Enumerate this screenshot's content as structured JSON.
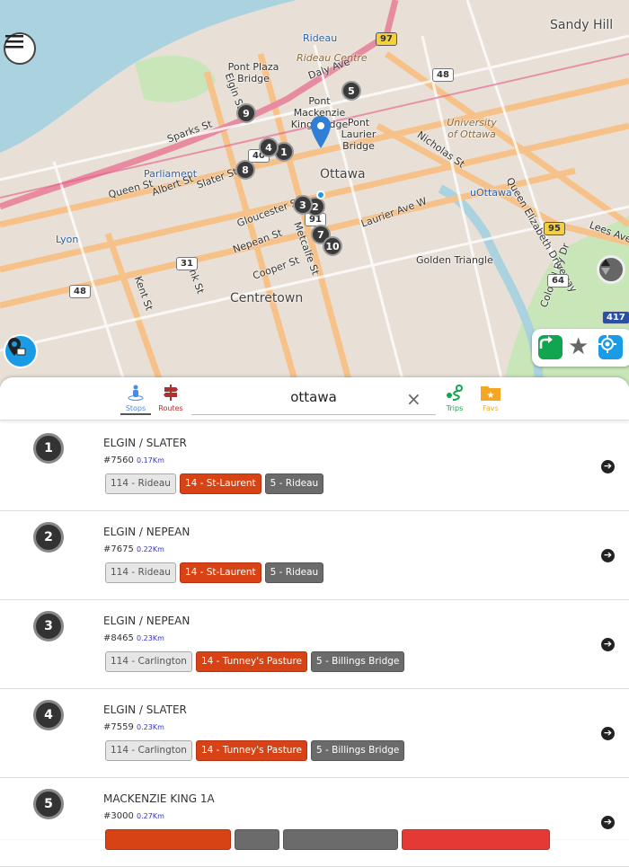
{
  "map": {
    "labels": [
      {
        "text": "Sandy Hill",
        "cls": "big"
      },
      {
        "text": "Rideau",
        "cls": "blue"
      },
      {
        "text": "Rideau Centre",
        "cls": "brown"
      },
      {
        "text": "Pont Plaza Bridge",
        "cls": ""
      },
      {
        "text": "Pont Mackenzie King Bridge",
        "cls": ""
      },
      {
        "text": "Pont Laurier Bridge",
        "cls": ""
      },
      {
        "text": "University of Ottawa",
        "cls": "brown"
      },
      {
        "text": "Parliament",
        "cls": "blue"
      },
      {
        "text": "Ottawa",
        "cls": "big"
      },
      {
        "text": "uOttawa",
        "cls": "blue"
      },
      {
        "text": "Lyon",
        "cls": "blue"
      },
      {
        "text": "Centretown",
        "cls": "big"
      },
      {
        "text": "Golden Triangle",
        "cls": ""
      },
      {
        "text": "Queen St",
        "cls": ""
      },
      {
        "text": "Albert St",
        "cls": ""
      },
      {
        "text": "Slater St",
        "cls": ""
      },
      {
        "text": "Laurier Ave W",
        "cls": ""
      },
      {
        "text": "Elgin St",
        "cls": ""
      },
      {
        "text": "Metcalfe St",
        "cls": ""
      },
      {
        "text": "Bank St",
        "cls": ""
      },
      {
        "text": "Kent St",
        "cls": ""
      },
      {
        "text": "Nicholas St",
        "cls": ""
      },
      {
        "text": "Colonel By Dr",
        "cls": ""
      },
      {
        "text": "Queen Elizabeth Driveway",
        "cls": ""
      },
      {
        "text": "Lees Ave",
        "cls": ""
      },
      {
        "text": "Daly Ave",
        "cls": ""
      },
      {
        "text": "Sparks St",
        "cls": ""
      },
      {
        "text": "Gloucester St",
        "cls": ""
      },
      {
        "text": "Nepean St",
        "cls": ""
      },
      {
        "text": "Cooper St",
        "cls": ""
      }
    ],
    "shields": [
      {
        "text": "97",
        "cls": "y"
      },
      {
        "text": "48",
        "cls": ""
      },
      {
        "text": "40",
        "cls": ""
      },
      {
        "text": "91",
        "cls": ""
      },
      {
        "text": "31",
        "cls": ""
      },
      {
        "text": "48",
        "cls": ""
      },
      {
        "text": "95",
        "cls": "y"
      },
      {
        "text": "64",
        "cls": ""
      },
      {
        "text": "417",
        "cls": "b"
      }
    ],
    "markers": [
      "1",
      "2",
      "3",
      "4",
      "5",
      "7",
      "8",
      "9",
      "10"
    ],
    "colors": {
      "route_green": "#12a550",
      "fav_gray": "#666666",
      "locate_blue": "#1a9be6",
      "map_bg": "#e8e0d6"
    }
  },
  "tabs": {
    "stops": "Stops",
    "routes": "Routes",
    "trips": "Trips",
    "favs": "Favs"
  },
  "search": {
    "value": "ottawa",
    "clear": "×"
  },
  "stops": [
    {
      "num": "1",
      "name": "ELGIN / SLATER",
      "code": "#7560",
      "dist": "0.17Km",
      "routes": [
        {
          "label": "114 - Rideau",
          "style": "light"
        },
        {
          "label": "14 - St-Laurent",
          "style": "orange"
        },
        {
          "label": "5 - Rideau",
          "style": "gray"
        }
      ]
    },
    {
      "num": "2",
      "name": "ELGIN / NEPEAN",
      "code": "#7675",
      "dist": "0.22Km",
      "routes": [
        {
          "label": "114 - Rideau",
          "style": "light"
        },
        {
          "label": "14 - St-Laurent",
          "style": "orange"
        },
        {
          "label": "5 - Rideau",
          "style": "gray"
        }
      ]
    },
    {
      "num": "3",
      "name": "ELGIN / NEPEAN",
      "code": "#8465",
      "dist": "0.23Km",
      "routes": [
        {
          "label": "114 - Carlington",
          "style": "light"
        },
        {
          "label": "14 - Tunney's Pasture",
          "style": "orange"
        },
        {
          "label": "5 - Billings Bridge",
          "style": "gray"
        }
      ]
    },
    {
      "num": "4",
      "name": "ELGIN / SLATER",
      "code": "#7559",
      "dist": "0.23Km",
      "routes": [
        {
          "label": "114 - Carlington",
          "style": "light"
        },
        {
          "label": "14 - Tunney's Pasture",
          "style": "orange"
        },
        {
          "label": "5 - Billings Bridge",
          "style": "gray"
        }
      ]
    },
    {
      "num": "5",
      "name": "MACKENZIE KING 1A",
      "code": "#3000",
      "dist": "0.27Km",
      "routes": [
        {
          "label": "",
          "style": "orange",
          "w": 140
        },
        {
          "label": "",
          "style": "gray",
          "w": 50
        },
        {
          "label": "",
          "style": "gray",
          "w": 128
        },
        {
          "label": "",
          "style": "red",
          "w": 165
        }
      ]
    }
  ]
}
